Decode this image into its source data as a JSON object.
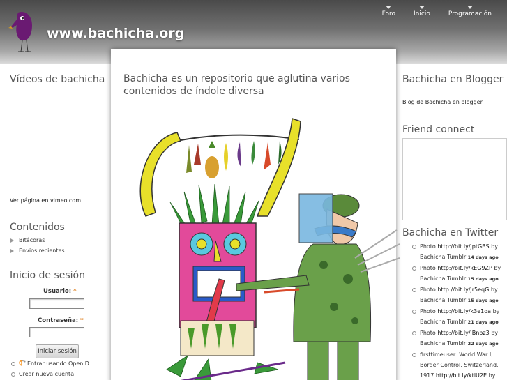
{
  "header": {
    "site_name": "www.bachicha.org",
    "nav": [
      "Foro",
      "Inicio",
      "Programación"
    ]
  },
  "center": {
    "intro": "Bachicha es un repositorio que aglutina varios contenidos de índole diversa"
  },
  "left": {
    "videos_title": "Vídeos de bachicha",
    "vimeo_link": "Ver página en vimeo.com",
    "contents_title": "Contenidos",
    "contents_items": [
      "Bitácoras",
      "Envíos recientes"
    ],
    "login_title": "Inicio de sesión",
    "username_label": "Usuario:",
    "password_label": "Contraseña:",
    "required_mark": "*",
    "login_button": "Iniciar sesión",
    "login_links": [
      "Entrar usando OpenID",
      "Crear nueva cuenta"
    ]
  },
  "right": {
    "blogger_title": "Bachicha en Blogger",
    "blogger_link": "Blog de Bachicha en blogger",
    "friend_title": "Friend connect",
    "twitter_title": "Bachicha en Twitter",
    "tweets": [
      {
        "prefix": "Photo ",
        "link": "http://bit.ly/jptGBS",
        "by": " by Bachicha Tumblr ",
        "ago": "14 days ago"
      },
      {
        "prefix": "Photo ",
        "link": "http://bit.ly/kEG9ZP",
        "by": " by Bachicha Tumblr ",
        "ago": "15 days ago"
      },
      {
        "prefix": "Photo ",
        "link": "http://bit.ly/jr5eqG",
        "by": " by Bachicha Tumblr ",
        "ago": "15 days ago"
      },
      {
        "prefix": "Photo ",
        "link": "http://bit.ly/k3e1oa",
        "by": " by Bachicha Tumblr ",
        "ago": "21 days ago"
      },
      {
        "prefix": "Photo ",
        "link": "http://bit.ly/lBnbz3",
        "by": " by Bachicha Tumblr ",
        "ago": "22 days ago"
      },
      {
        "prefix": "firsttimeuser: World War I, Border Control, Switzerland, 1917 ",
        "link": "http://bit.ly/ktlU2E",
        "by": " by",
        "ago": ""
      }
    ]
  }
}
